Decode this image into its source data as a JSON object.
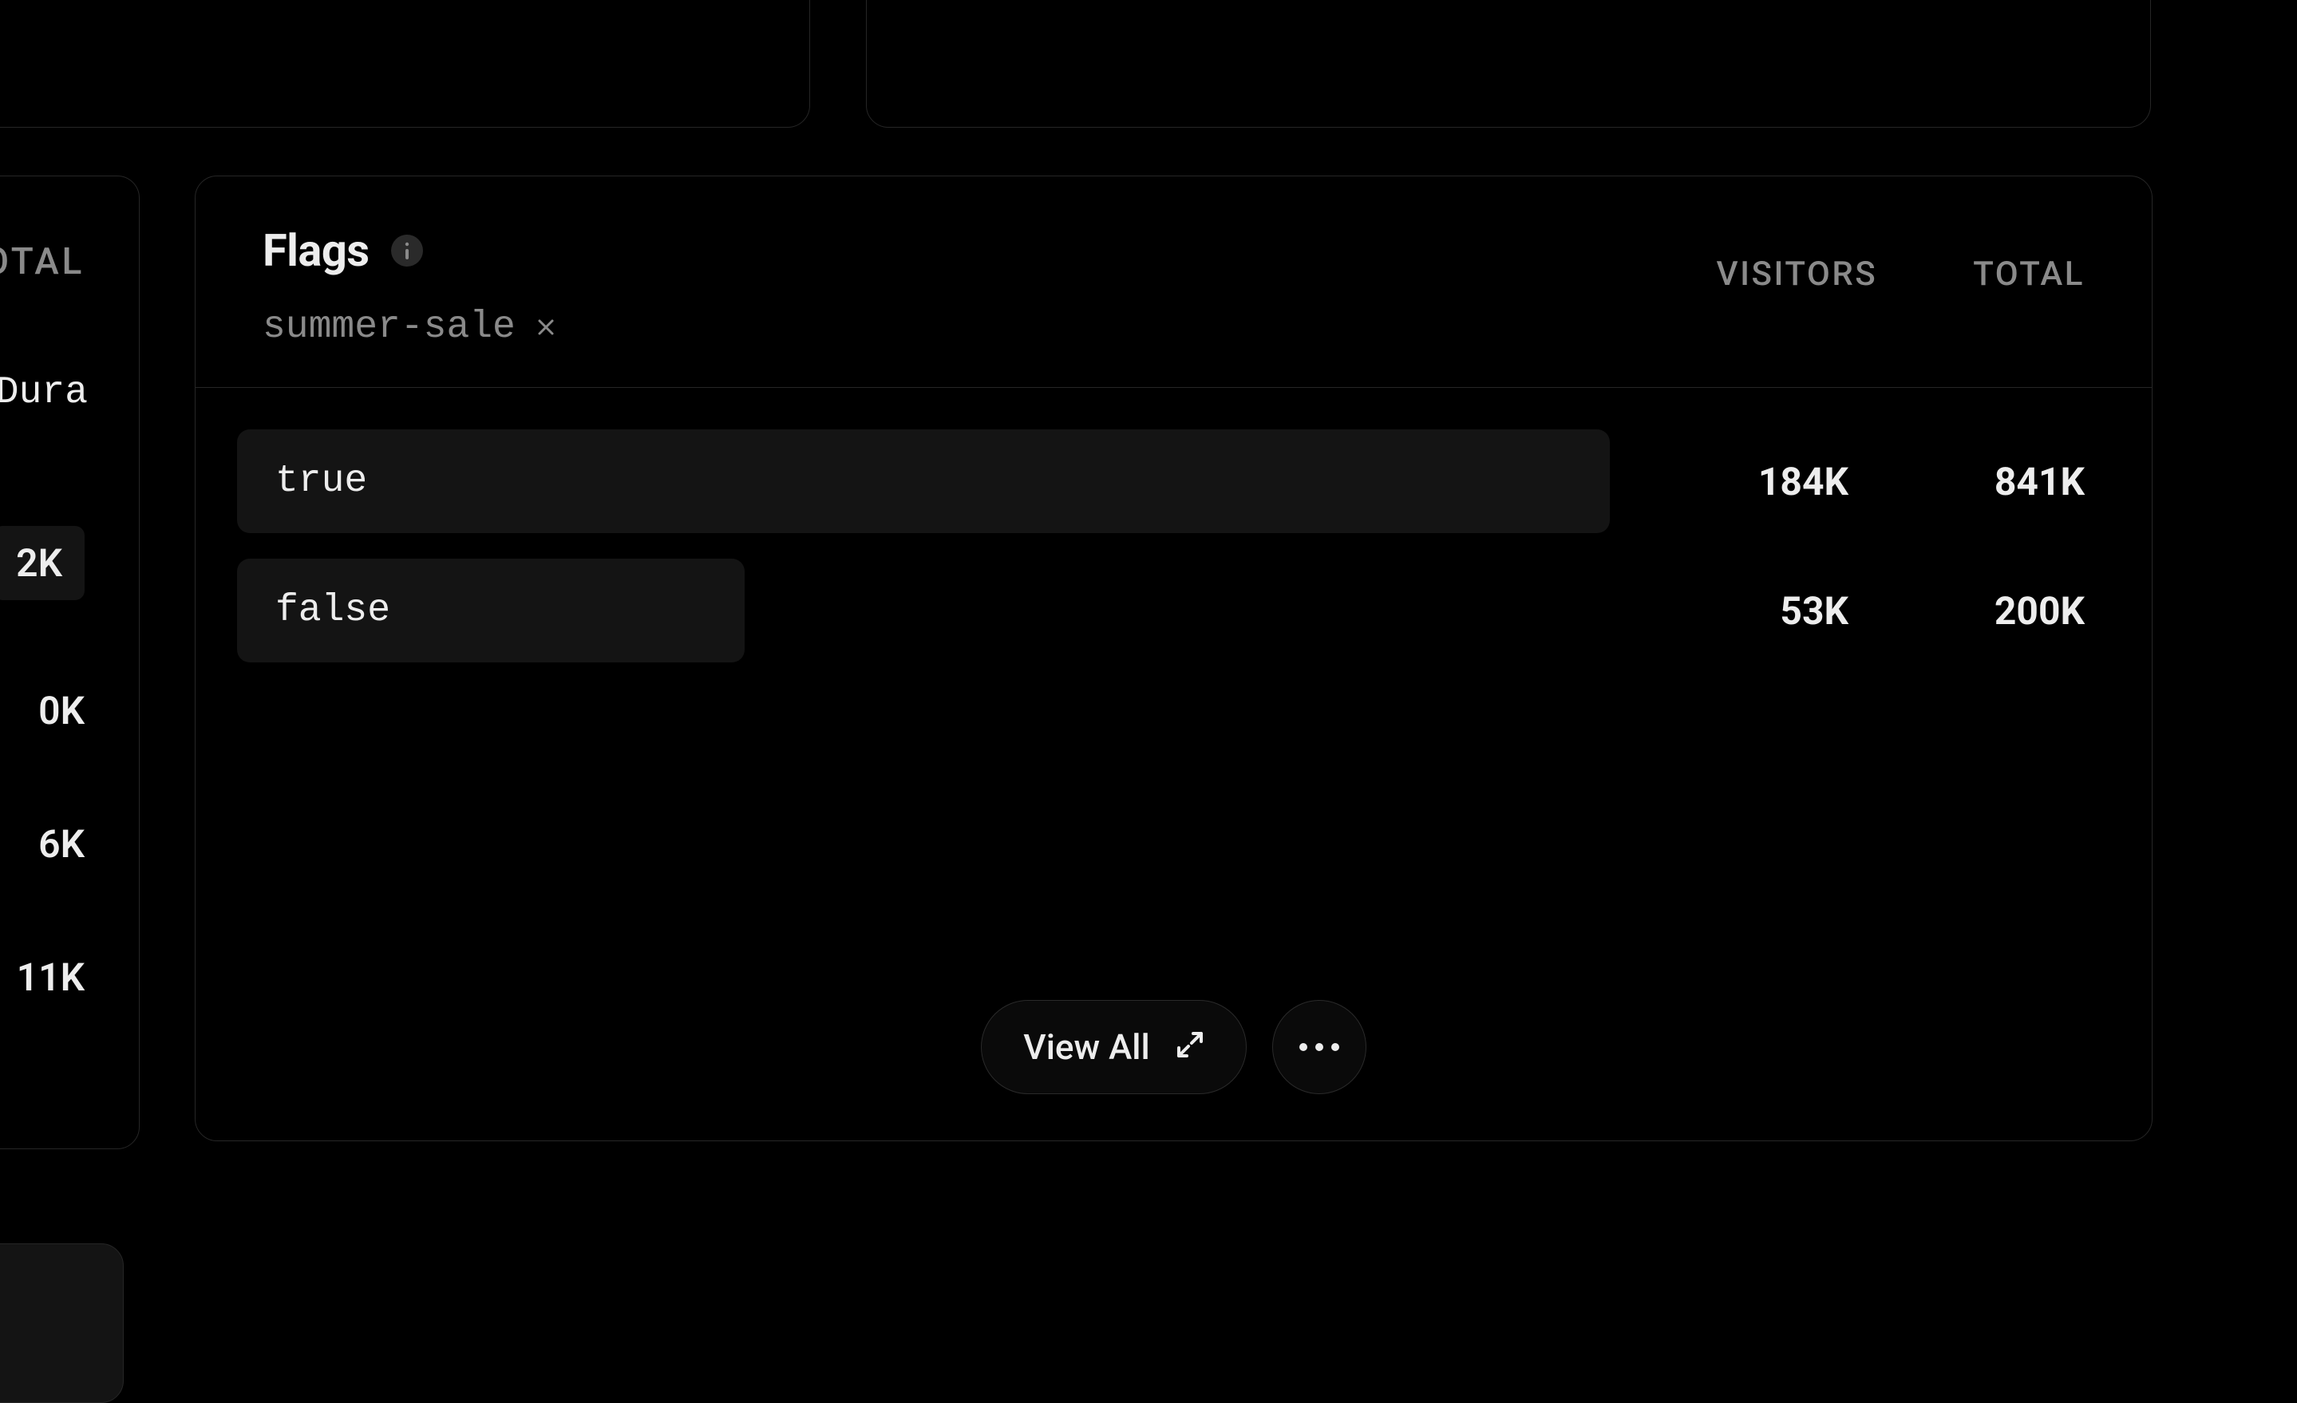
{
  "leftCard": {
    "header": "OTAL",
    "label": "estDura",
    "values": [
      "2K",
      "0K",
      "6K",
      "11K"
    ]
  },
  "flags": {
    "title": "Flags",
    "activeFlag": "summer-sale",
    "columns": {
      "visitors": "VISITORS",
      "total": "TOTAL"
    },
    "rows": [
      {
        "label": "true",
        "visitors": "184K",
        "total": "841K",
        "barWidth": 100
      },
      {
        "label": "false",
        "visitors": "53K",
        "total": "200K",
        "barWidth": 37
      }
    ],
    "viewAllLabel": "View All"
  }
}
